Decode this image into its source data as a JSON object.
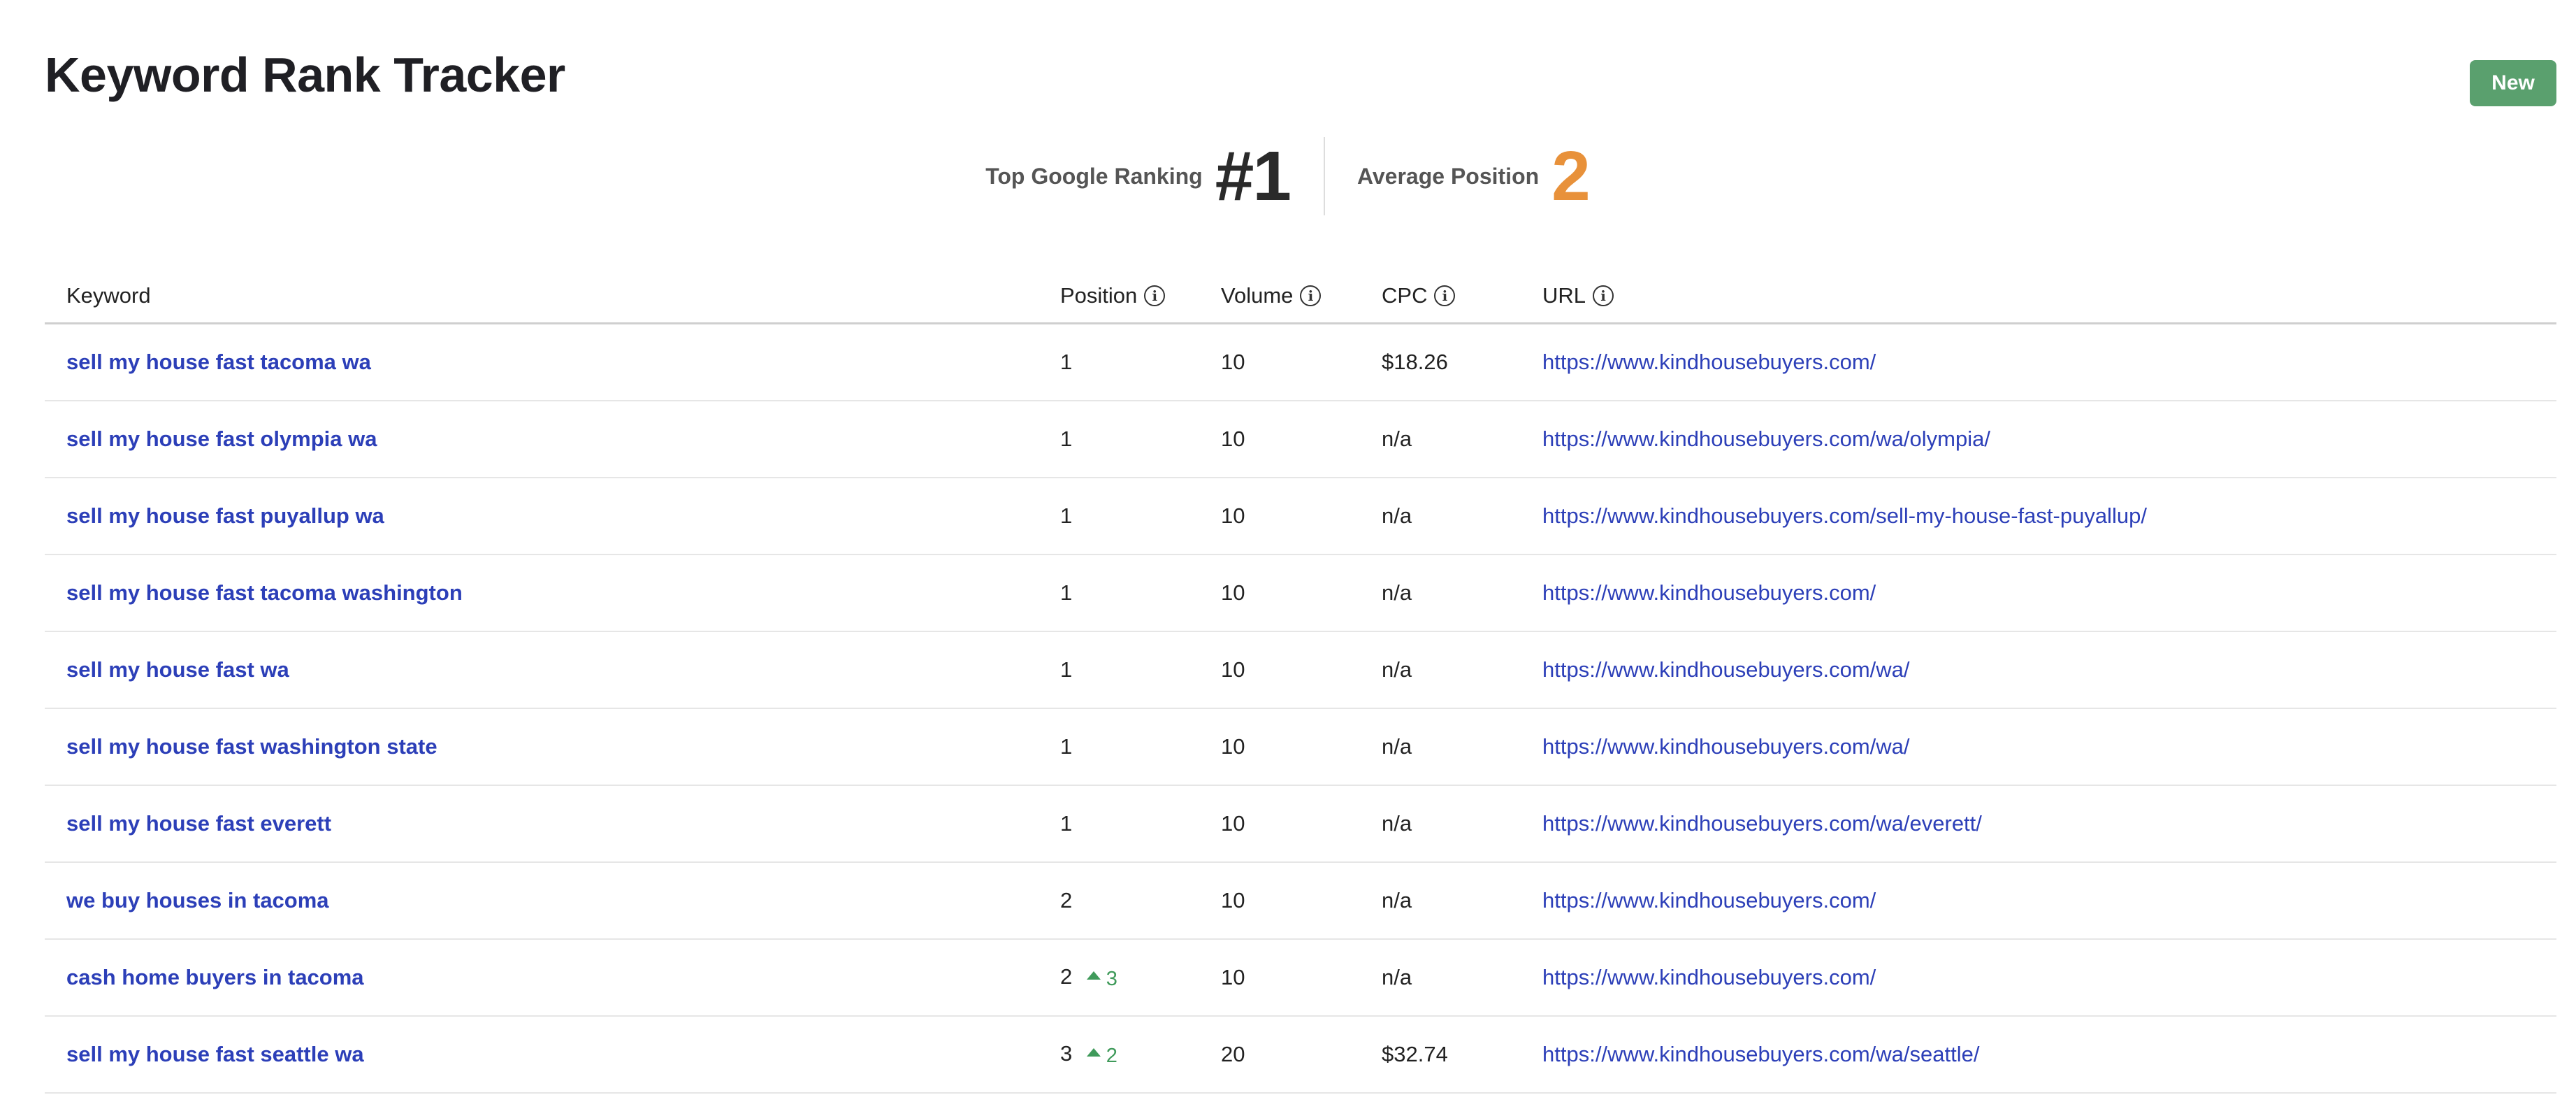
{
  "header": {
    "title": "Keyword Rank Tracker",
    "new_button": "New"
  },
  "stats": {
    "top_ranking_label": "Top Google Ranking",
    "top_ranking_value": "#1",
    "average_position_label": "Average Position",
    "average_position_value": "2"
  },
  "colors": {
    "new_button": "#5aa06e",
    "average_position": "#e8913a",
    "link": "#2c3fb8",
    "rank_change_up": "#3f9a5a"
  },
  "table": {
    "columns": {
      "keyword": "Keyword",
      "position": "Position",
      "volume": "Volume",
      "cpc": "CPC",
      "url": "URL"
    },
    "info_icon_glyph": "i",
    "rows": [
      {
        "keyword": "sell my house fast tacoma wa",
        "position": "1",
        "change": "",
        "volume": "10",
        "cpc": "$18.26",
        "url": "https://www.kindhousebuyers.com/"
      },
      {
        "keyword": "sell my house fast olympia wa",
        "position": "1",
        "change": "",
        "volume": "10",
        "cpc": "n/a",
        "url": "https://www.kindhousebuyers.com/wa/olympia/"
      },
      {
        "keyword": "sell my house fast puyallup wa",
        "position": "1",
        "change": "",
        "volume": "10",
        "cpc": "n/a",
        "url": "https://www.kindhousebuyers.com/sell-my-house-fast-puyallup/"
      },
      {
        "keyword": "sell my house fast tacoma washington",
        "position": "1",
        "change": "",
        "volume": "10",
        "cpc": "n/a",
        "url": "https://www.kindhousebuyers.com/"
      },
      {
        "keyword": "sell my house fast wa",
        "position": "1",
        "change": "",
        "volume": "10",
        "cpc": "n/a",
        "url": "https://www.kindhousebuyers.com/wa/"
      },
      {
        "keyword": "sell my house fast washington state",
        "position": "1",
        "change": "",
        "volume": "10",
        "cpc": "n/a",
        "url": "https://www.kindhousebuyers.com/wa/"
      },
      {
        "keyword": "sell my house fast everett",
        "position": "1",
        "change": "",
        "volume": "10",
        "cpc": "n/a",
        "url": "https://www.kindhousebuyers.com/wa/everett/"
      },
      {
        "keyword": "we buy houses in tacoma",
        "position": "2",
        "change": "",
        "volume": "10",
        "cpc": "n/a",
        "url": "https://www.kindhousebuyers.com/"
      },
      {
        "keyword": "cash home buyers in tacoma",
        "position": "2",
        "change": "3",
        "volume": "10",
        "cpc": "n/a",
        "url": "https://www.kindhousebuyers.com/"
      },
      {
        "keyword": "sell my house fast seattle wa",
        "position": "3",
        "change": "2",
        "volume": "20",
        "cpc": "$32.74",
        "url": "https://www.kindhousebuyers.com/wa/seattle/"
      }
    ]
  }
}
